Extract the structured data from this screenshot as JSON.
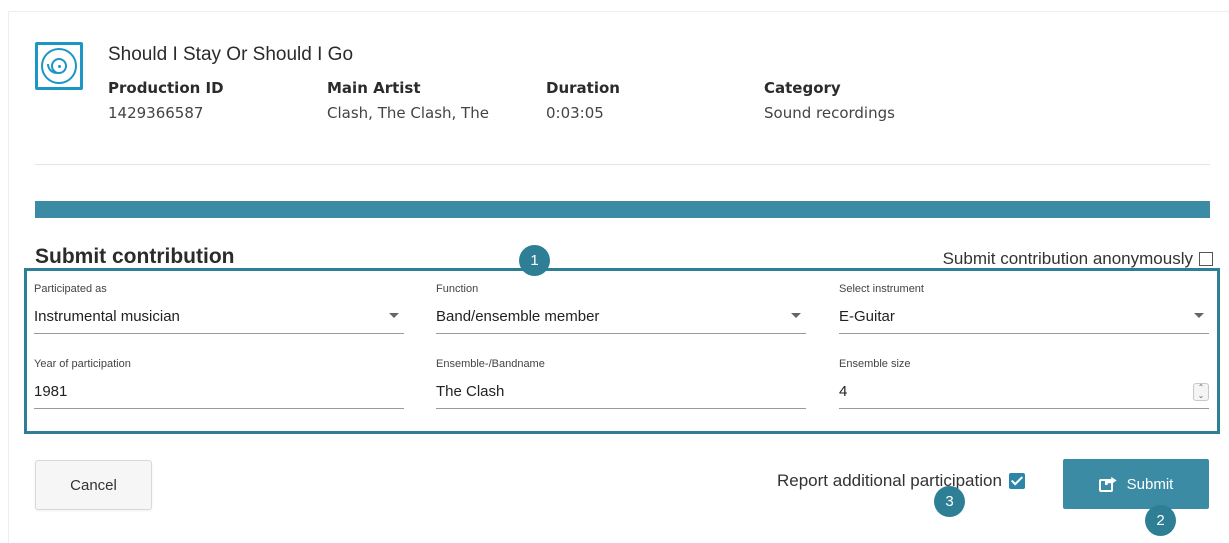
{
  "production": {
    "title": "Should I Stay Or Should I Go",
    "meta": [
      {
        "label": "Production ID",
        "value": "1429366587"
      },
      {
        "label": "Main Artist",
        "value": "Clash, The Clash, The"
      },
      {
        "label": "Duration",
        "value": "0:03:05"
      },
      {
        "label": "Category",
        "value": "Sound recordings"
      }
    ],
    "icon": "cd-case-icon"
  },
  "contribution": {
    "title": "Submit contribution",
    "anonymous_label": "Submit contribution anonymously",
    "anonymous_checked": false,
    "fields": {
      "participated_as": {
        "label": "Participated as",
        "value": "Instrumental musician"
      },
      "function": {
        "label": "Function",
        "value": "Band/ensemble member"
      },
      "instrument": {
        "label": "Select instrument",
        "value": "E-Guitar"
      },
      "year": {
        "label": "Year of participation",
        "value": "1981"
      },
      "bandname": {
        "label": "Ensemble-/Bandname",
        "value": "The Clash"
      },
      "ensemble_size": {
        "label": "Ensemble size",
        "value": "4"
      }
    }
  },
  "actions": {
    "cancel_label": "Cancel",
    "report_label": "Report additional participation",
    "report_checked": true,
    "submit_label": "Submit",
    "submit_icon": "share-icon"
  },
  "annotations": {
    "badge_1": "1",
    "badge_2": "2",
    "badge_3": "3"
  },
  "colors": {
    "accent": "#3b8ba4",
    "highlight_border": "#2e7f95",
    "icon": "#1b96c5"
  }
}
